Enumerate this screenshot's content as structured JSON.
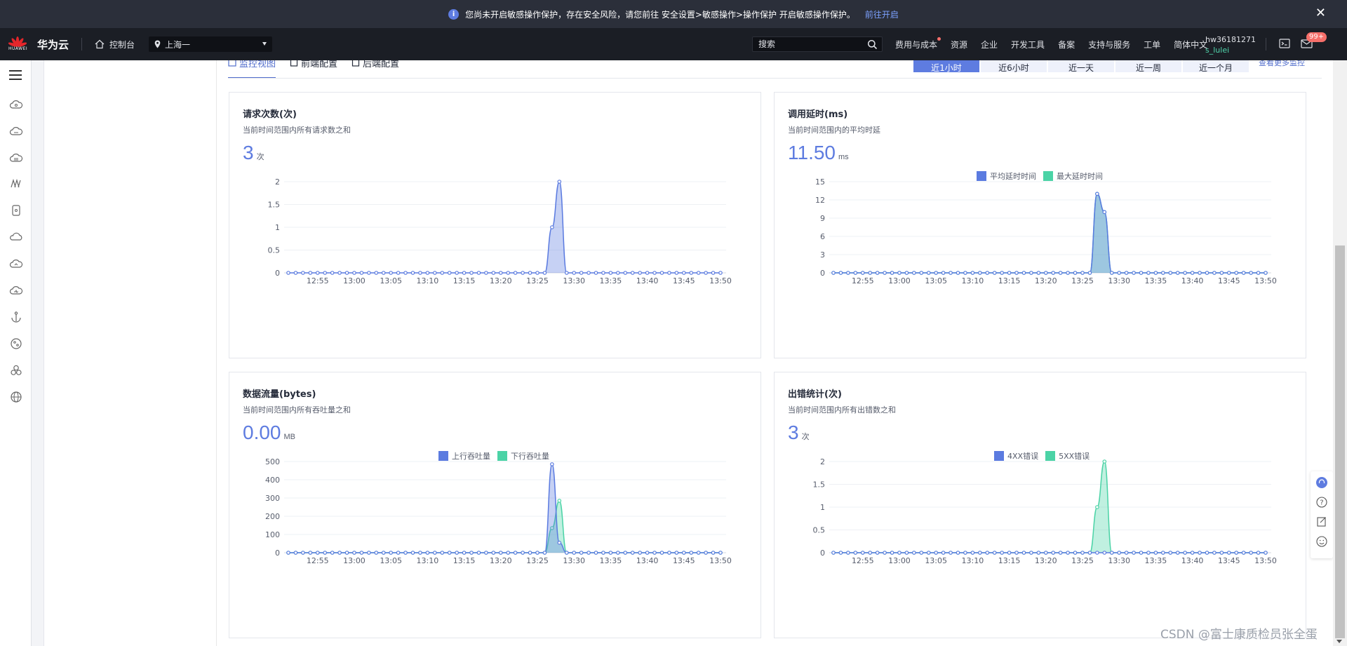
{
  "banner": {
    "message": "您尚未开启敏感操作保护，存在安全风险，请您前往 安全设置>敏感操作>操作保护 开启敏感操作保护。",
    "link": "前往开启"
  },
  "nav": {
    "brand_small": "HUAWEI",
    "brand": "华为云",
    "console": "控制台",
    "region": "上海一",
    "search_placeholder": "搜索",
    "links": [
      "费用与成本",
      "资源",
      "企业",
      "开发工具",
      "备案",
      "支持与服务",
      "工单",
      "简体中文"
    ],
    "user_id": "hw36181271",
    "user_name": "s_lulei",
    "badge": "99+"
  },
  "tabs": [
    "监控视图",
    "前端配置",
    "后端配置"
  ],
  "ranges": [
    "近1小时",
    "近6小时",
    "近一天",
    "近一周",
    "近一个月"
  ],
  "more_link": "查看更多监控",
  "cards": [
    {
      "title": "请求次数(次)",
      "subtitle": "当前时间范围内所有请求数之和",
      "value": "3",
      "unit": "次"
    },
    {
      "title": "调用延时(ms)",
      "subtitle": "当前时间范围内的平均时延",
      "value": "11.50",
      "unit": "ms"
    },
    {
      "title": "数据流量(bytes)",
      "subtitle": "当前时间范围内所有吞吐量之和",
      "value": "0.00",
      "unit": "MB"
    },
    {
      "title": "出错统计(次)",
      "subtitle": "当前时间范围内所有出错数之和",
      "value": "3",
      "unit": "次"
    }
  ],
  "colors": {
    "blue": "#5b7be0",
    "green": "#4bd3a6"
  },
  "chart_data": [
    {
      "type": "area",
      "x_labels": [
        "12:55",
        "13:00",
        "13:05",
        "13:10",
        "13:15",
        "13:20",
        "13:25",
        "13:30",
        "13:35",
        "13:40",
        "13:45",
        "13:50"
      ],
      "yticks": [
        "0",
        "0.5",
        "1",
        "1.5",
        "2"
      ],
      "ylim": [
        0,
        2
      ],
      "series": [
        {
          "color": "#5b7be0",
          "peaks": [
            [
              36,
              1
            ],
            [
              37,
              2
            ]
          ]
        }
      ]
    },
    {
      "type": "area",
      "x_labels": [
        "12:55",
        "13:00",
        "13:05",
        "13:10",
        "13:15",
        "13:20",
        "13:25",
        "13:30",
        "13:35",
        "13:40",
        "13:45",
        "13:50"
      ],
      "yticks": [
        "0",
        "3",
        "6",
        "9",
        "12",
        "15"
      ],
      "ylim": [
        0,
        15
      ],
      "legend": [
        "平均延时时间",
        "最大延时时间"
      ],
      "series": [
        {
          "name": "平均延时时间",
          "color": "#5b7be0",
          "peaks": [
            [
              36,
              13
            ],
            [
              37,
              10
            ]
          ]
        },
        {
          "name": "最大延时时间",
          "color": "#4bd3a6",
          "peaks": [
            [
              36,
              13
            ],
            [
              37,
              10
            ]
          ]
        }
      ]
    },
    {
      "type": "area",
      "x_labels": [
        "12:55",
        "13:00",
        "13:05",
        "13:10",
        "13:15",
        "13:20",
        "13:25",
        "13:30",
        "13:35",
        "13:40",
        "13:45",
        "13:50"
      ],
      "yticks": [
        "0",
        "100",
        "200",
        "300",
        "400",
        "500"
      ],
      "ylim": [
        0,
        500
      ],
      "legend": [
        "上行吞吐量",
        "下行吞吐量"
      ],
      "series": [
        {
          "name": "上行吞吐量",
          "color": "#5b7be0",
          "peaks": [
            [
              36,
              485
            ],
            [
              37,
              55
            ]
          ]
        },
        {
          "name": "下行吞吐量",
          "color": "#4bd3a6",
          "peaks": [
            [
              36,
              135
            ],
            [
              37,
              285
            ]
          ]
        }
      ]
    },
    {
      "type": "area",
      "x_labels": [
        "12:55",
        "13:00",
        "13:05",
        "13:10",
        "13:15",
        "13:20",
        "13:25",
        "13:30",
        "13:35",
        "13:40",
        "13:45",
        "13:50"
      ],
      "yticks": [
        "0",
        "0.5",
        "1",
        "1.5",
        "2"
      ],
      "ylim": [
        0,
        2
      ],
      "legend": [
        "4XX错误",
        "5XX错误"
      ],
      "series": [
        {
          "name": "4XX错误",
          "color": "#5b7be0",
          "peaks": []
        },
        {
          "name": "5XX错误",
          "color": "#4bd3a6",
          "peaks": [
            [
              36,
              1
            ],
            [
              37,
              2
            ]
          ]
        }
      ]
    }
  ],
  "watermark": "CSDN @富士康质检员张全蛋"
}
